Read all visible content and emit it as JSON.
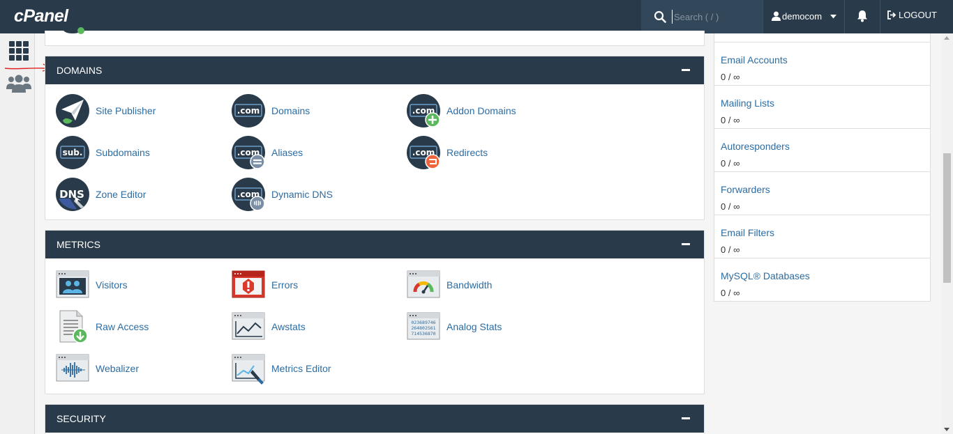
{
  "header": {
    "logo": "cPanel",
    "search_placeholder": "Search ( / )",
    "username": "democom",
    "logout_label": "LOGOUT"
  },
  "sections": {
    "domains": {
      "title": "DOMAINS",
      "items": [
        "Site Publisher",
        "Domains",
        "Addon Domains",
        "Subdomains",
        "Aliases",
        "Redirects",
        "Zone Editor",
        "Dynamic DNS"
      ]
    },
    "metrics": {
      "title": "METRICS",
      "items": [
        "Visitors",
        "Errors",
        "Bandwidth",
        "Raw Access",
        "Awstats",
        "Analog Stats",
        "Webalizer",
        "Metrics Editor"
      ]
    },
    "security": {
      "title": "SECURITY"
    }
  },
  "icon_text": {
    "dotcom": ".com",
    "sub": "sub.",
    "dns": "DNS",
    "analog_digits": [
      "023689746",
      "264802561",
      "714536870"
    ]
  },
  "stats": [
    {
      "name": "Email Accounts",
      "value": "0 / ∞"
    },
    {
      "name": "Mailing Lists",
      "value": "0 / ∞"
    },
    {
      "name": "Autoresponders",
      "value": "0 / ∞"
    },
    {
      "name": "Forwarders",
      "value": "0 / ∞"
    },
    {
      "name": "Email Filters",
      "value": "0 / ∞"
    },
    {
      "name": "MySQL® Databases",
      "value": "0 / ∞"
    }
  ],
  "icons": {
    "search": "search-icon",
    "user": "user-icon",
    "caret": "caret-down-icon",
    "bell": "bell-icon",
    "logout": "logout-icon",
    "grid": "grid-icon",
    "users": "users-icon"
  },
  "colors": {
    "header_bg": "#293a4a",
    "link": "#2b6ca3",
    "icon_dark": "#293a4a",
    "green": "#5cb85c",
    "orange": "#f0643c",
    "red": "#d9382c"
  }
}
